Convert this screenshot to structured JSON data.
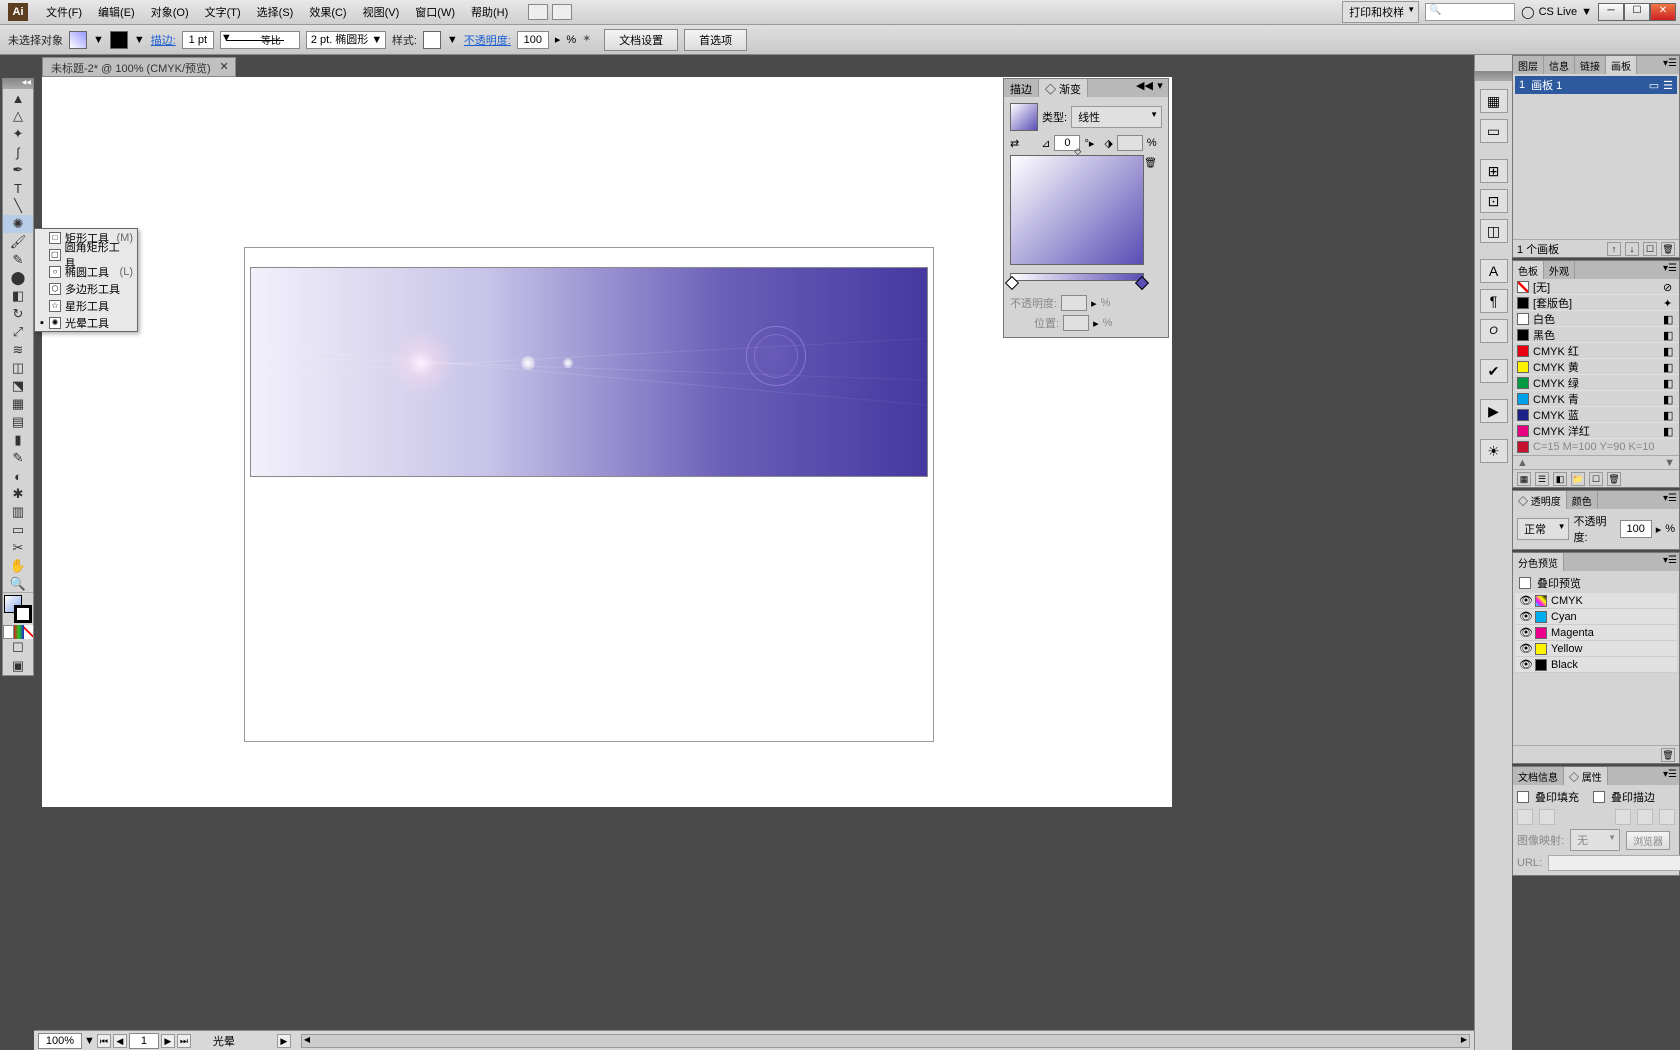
{
  "menubar": {
    "items": [
      "文件(F)",
      "编辑(E)",
      "对象(O)",
      "文字(T)",
      "选择(S)",
      "效果(C)",
      "视图(V)",
      "窗口(W)",
      "帮助(H)"
    ],
    "workspace": "打印和校样",
    "cslive": "CS Live"
  },
  "controlbar": {
    "no_selection": "未选择对象",
    "stroke_label": "描边:",
    "stroke_weight": "1 pt",
    "uniform": "等比",
    "profile": "2 pt. 椭圆形",
    "style_label": "样式:",
    "opacity_label": "不透明度:",
    "opacity_value": "100",
    "opacity_suffix": "%",
    "doc_setup": "文档设置",
    "prefs": "首选项"
  },
  "doc_tab": "未标题-2* @ 100% (CMYK/预览)",
  "status": {
    "zoom": "100%",
    "page": "1",
    "tool_label": "光晕"
  },
  "flyout": {
    "items": [
      {
        "icon": "□",
        "label": "矩形工具",
        "sc": "(M)"
      },
      {
        "icon": "▢",
        "label": "圆角矩形工具",
        "sc": ""
      },
      {
        "icon": "○",
        "label": "椭圆工具",
        "sc": "(L)"
      },
      {
        "icon": "⬡",
        "label": "多边形工具",
        "sc": ""
      },
      {
        "icon": "☆",
        "label": "星形工具",
        "sc": ""
      },
      {
        "icon": "✺",
        "label": "光晕工具",
        "sc": ""
      }
    ]
  },
  "gradient_panel": {
    "tab_stroke": "描边",
    "tab_gradient": "◇ 渐变",
    "type_label": "类型:",
    "type_value": "线性",
    "angle": "0",
    "opacity_label": "不透明度:",
    "position_label": "位置:",
    "percent": "%"
  },
  "artboards_panel": {
    "tabs": [
      "图层",
      "信息",
      "链接",
      "画板"
    ],
    "row_num": "1",
    "row_name": "画板 1",
    "footer": "1 个画板"
  },
  "swatches_panel": {
    "tabs": [
      "色板",
      "外观"
    ],
    "items": [
      {
        "c": "none",
        "name": "[无]",
        "t": "⊘"
      },
      {
        "c": "#000",
        "name": "[套版色]",
        "t": "✦"
      },
      {
        "c": "#fff",
        "name": "白色",
        "t": "◧"
      },
      {
        "c": "#000",
        "name": "黑色",
        "t": "◧"
      },
      {
        "c": "#e60012",
        "name": "CMYK 红",
        "t": "◧"
      },
      {
        "c": "#fff100",
        "name": "CMYK 黄",
        "t": "◧"
      },
      {
        "c": "#009944",
        "name": "CMYK 绿",
        "t": "◧"
      },
      {
        "c": "#00a0e9",
        "name": "CMYK 青",
        "t": "◧"
      },
      {
        "c": "#1d2088",
        "name": "CMYK 蓝",
        "t": "◧"
      },
      {
        "c": "#e4007f",
        "name": "CMYK 洋红",
        "t": "◧"
      }
    ],
    "overflow": "C=15 M=100 Y=90 K=10"
  },
  "opacity_panel": {
    "tabs": [
      "◇ 透明度",
      "颜色"
    ],
    "mode": "正常",
    "opacity_label": "不透明度:",
    "opacity_value": "100",
    "percent": "%"
  },
  "sep_panel": {
    "tab": "分色预览",
    "overprint": "叠印预览",
    "inks": [
      {
        "c": "linear-gradient(45deg,#0ff,#f0f,#ff0,#000)",
        "name": "CMYK"
      },
      {
        "c": "#00aeef",
        "name": "Cyan"
      },
      {
        "c": "#ec008c",
        "name": "Magenta"
      },
      {
        "c": "#fff200",
        "name": "Yellow"
      },
      {
        "c": "#000",
        "name": "Black"
      }
    ]
  },
  "docinfo_panel": {
    "tabs": [
      "文档信息",
      "◇ 属性"
    ],
    "overprint_fill": "叠印填充",
    "overprint_stroke": "叠印描边",
    "imagemap_label": "图像映射:",
    "imagemap_value": "无",
    "browser_btn": "浏览器",
    "url_label": "URL:"
  }
}
